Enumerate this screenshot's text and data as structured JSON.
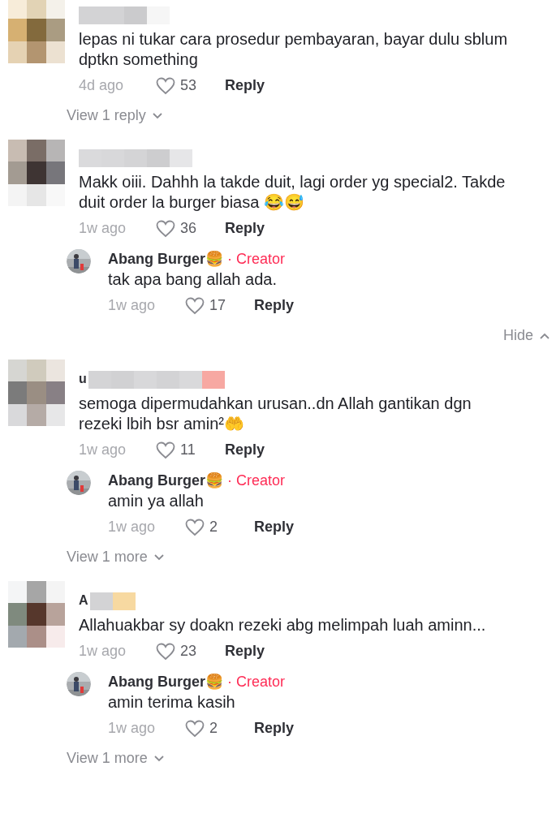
{
  "comments": [
    {
      "text": "lepas ni tukar cara prosedur pembayaran, bayar dulu sblum dptkn something",
      "time": "4d ago",
      "likes": "53",
      "reply_label": "Reply",
      "footer": {
        "kind": "view",
        "label": "View 1 reply"
      }
    },
    {
      "text": "Makk oiii. Dahhh la takde duit, lagi order yg special2. Takde duit order la burger biasa 😂😅",
      "time": "1w ago",
      "likes": "36",
      "reply_label": "Reply",
      "replies": [
        {
          "name": "Abang Burger🍔",
          "badge": "· Creator",
          "text": "tak apa bang allah ada.",
          "time": "1w ago",
          "likes": "17",
          "reply_label": "Reply"
        }
      ],
      "footer": {
        "kind": "hide",
        "label": "Hide"
      }
    },
    {
      "name_prefix": "u",
      "text": "semoga dipermudahkan urusan..dn Allah gantikan dgn rezeki lbih bsr amin²🤲",
      "time": "1w ago",
      "likes": "11",
      "reply_label": "Reply",
      "replies": [
        {
          "name": "Abang Burger🍔",
          "badge": "· Creator",
          "text": "amin ya allah",
          "time": "1w ago",
          "likes": "2",
          "reply_label": "Reply"
        }
      ],
      "footer": {
        "kind": "view",
        "label": "View 1 more"
      }
    },
    {
      "name_prefix": "A",
      "text": "Allahuakbar sy doakn rezeki abg melimpah luah aminn...",
      "time": "1w ago",
      "likes": "23",
      "reply_label": "Reply",
      "replies": [
        {
          "name": "Abang Burger🍔",
          "badge": "· Creator",
          "text": "amin terima kasih",
          "time": "1w ago",
          "likes": "2",
          "reply_label": "Reply"
        }
      ],
      "footer": {
        "kind": "view",
        "label": "View 1 more"
      }
    }
  ]
}
